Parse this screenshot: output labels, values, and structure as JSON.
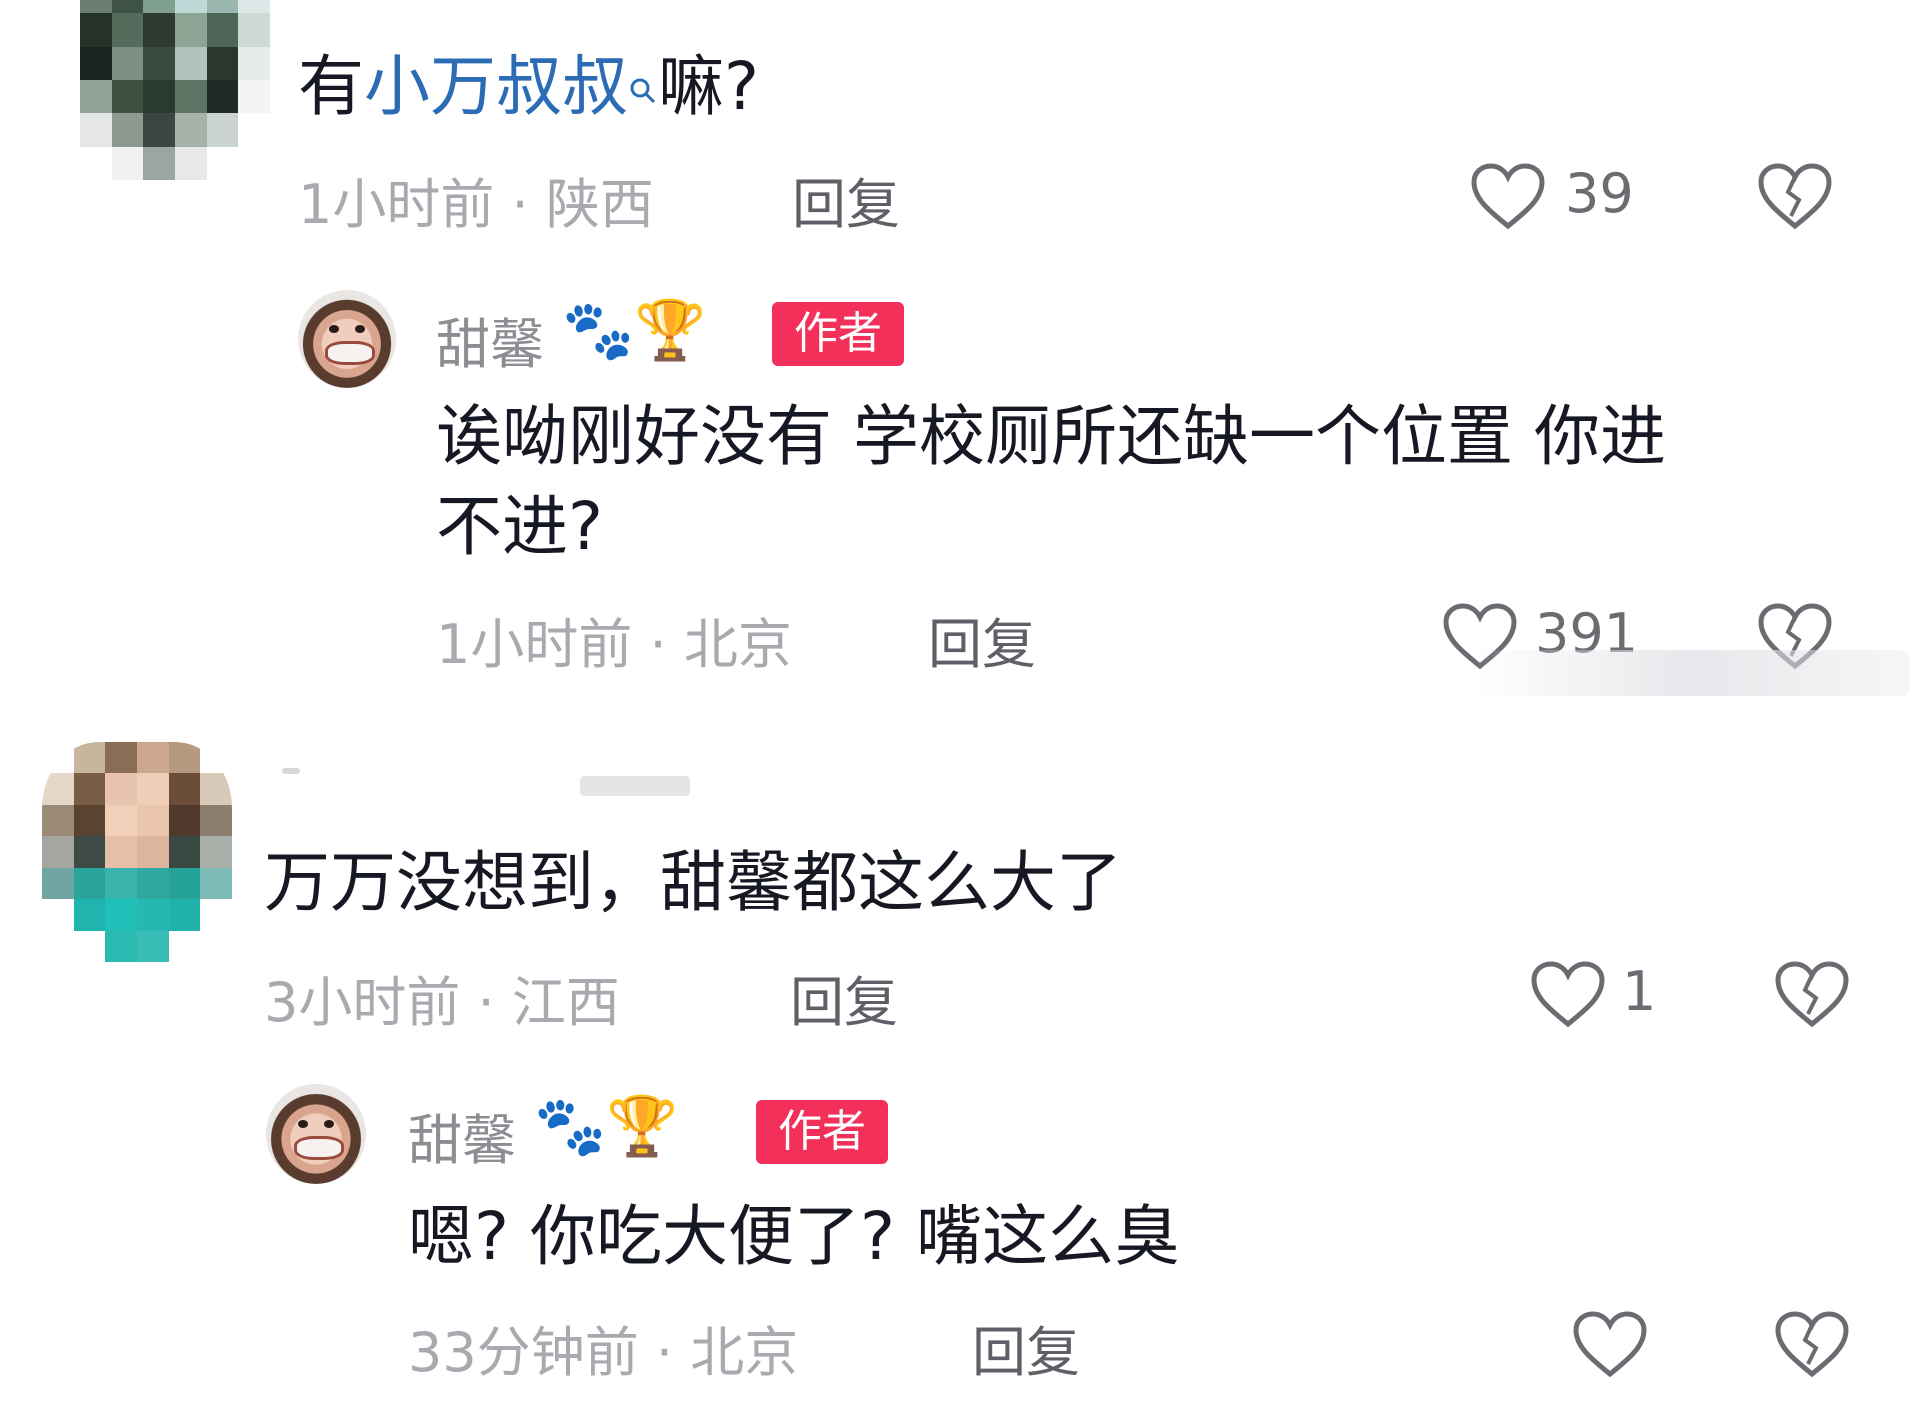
{
  "comments": [
    {
      "text_prefix": "有",
      "text_link": "小万叔叔",
      "link_mark": "ᵒ",
      "text_suffix": "嘛?",
      "time_location": "1小时前 · 陕西",
      "reply_label": "回复",
      "likes": "39",
      "replies": [
        {
          "username": "甜馨",
          "emojis": "🐾🏆",
          "badge": "作者",
          "text_line1": "诶呦刚好没有 学校厕所还缺一个位置 你进",
          "text_line2": "不进?",
          "time_location": "1小时前 · 北京",
          "reply_label": "回复",
          "likes": "391"
        }
      ]
    },
    {
      "text": "万万没想到，甜馨都这么大了",
      "time_location": "3小时前 · 江西",
      "reply_label": "回复",
      "likes": "1",
      "replies": [
        {
          "username": "甜馨",
          "emojis": "🐾🏆",
          "badge": "作者",
          "text": "嗯? 你吃大便了? 嘴这么臭",
          "time_location": "33分钟前 · 北京",
          "reply_label": "回复",
          "likes": ""
        }
      ]
    }
  ],
  "colors": {
    "link": "#2b6cb5",
    "author_badge": "#f2305a",
    "meta_text": "#a9aab0"
  },
  "icons": {
    "like": "heart-outline-icon",
    "dislike": "broken-heart-icon",
    "search": "search-icon"
  }
}
